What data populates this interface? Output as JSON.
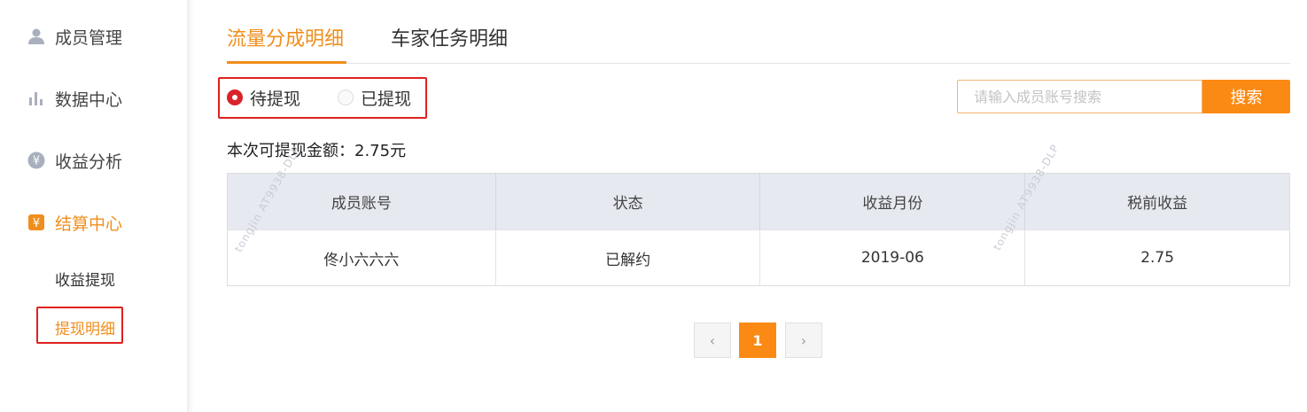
{
  "sidebar": {
    "items": [
      {
        "label": "成员管理",
        "icon": "user-icon"
      },
      {
        "label": "数据中心",
        "icon": "bar-chart-icon"
      },
      {
        "label": "收益分析",
        "icon": "yen-icon"
      },
      {
        "label": "结算中心",
        "icon": "settlement-icon"
      }
    ],
    "sub_items": [
      {
        "label": "收益提现"
      },
      {
        "label": "提现明细"
      }
    ]
  },
  "tabs": [
    {
      "label": "流量分成明细"
    },
    {
      "label": "车家任务明细"
    }
  ],
  "filter": {
    "options": [
      {
        "label": "待提现",
        "selected": true
      },
      {
        "label": "已提现",
        "selected": false
      }
    ]
  },
  "search": {
    "placeholder": "请输入成员账号搜索",
    "value": "",
    "button_label": "搜索"
  },
  "amount_text": "本次可提现金额：2.75元",
  "table": {
    "columns": [
      "成员账号",
      "状态",
      "收益月份",
      "税前收益"
    ],
    "rows": [
      [
        "佟小六六六",
        "已解约",
        "2019-06",
        "2.75"
      ]
    ]
  },
  "watermarks": [
    "tongjin  AT9938-DLP",
    "tongjin  AT9938-DLP"
  ],
  "pagination": {
    "prev": "‹",
    "pages": [
      "1"
    ],
    "next": "›"
  },
  "colors": {
    "accent": "#f08e1c",
    "button": "#fb8a14",
    "highlight_border": "#e02020",
    "radio_selected": "#d9222a"
  }
}
